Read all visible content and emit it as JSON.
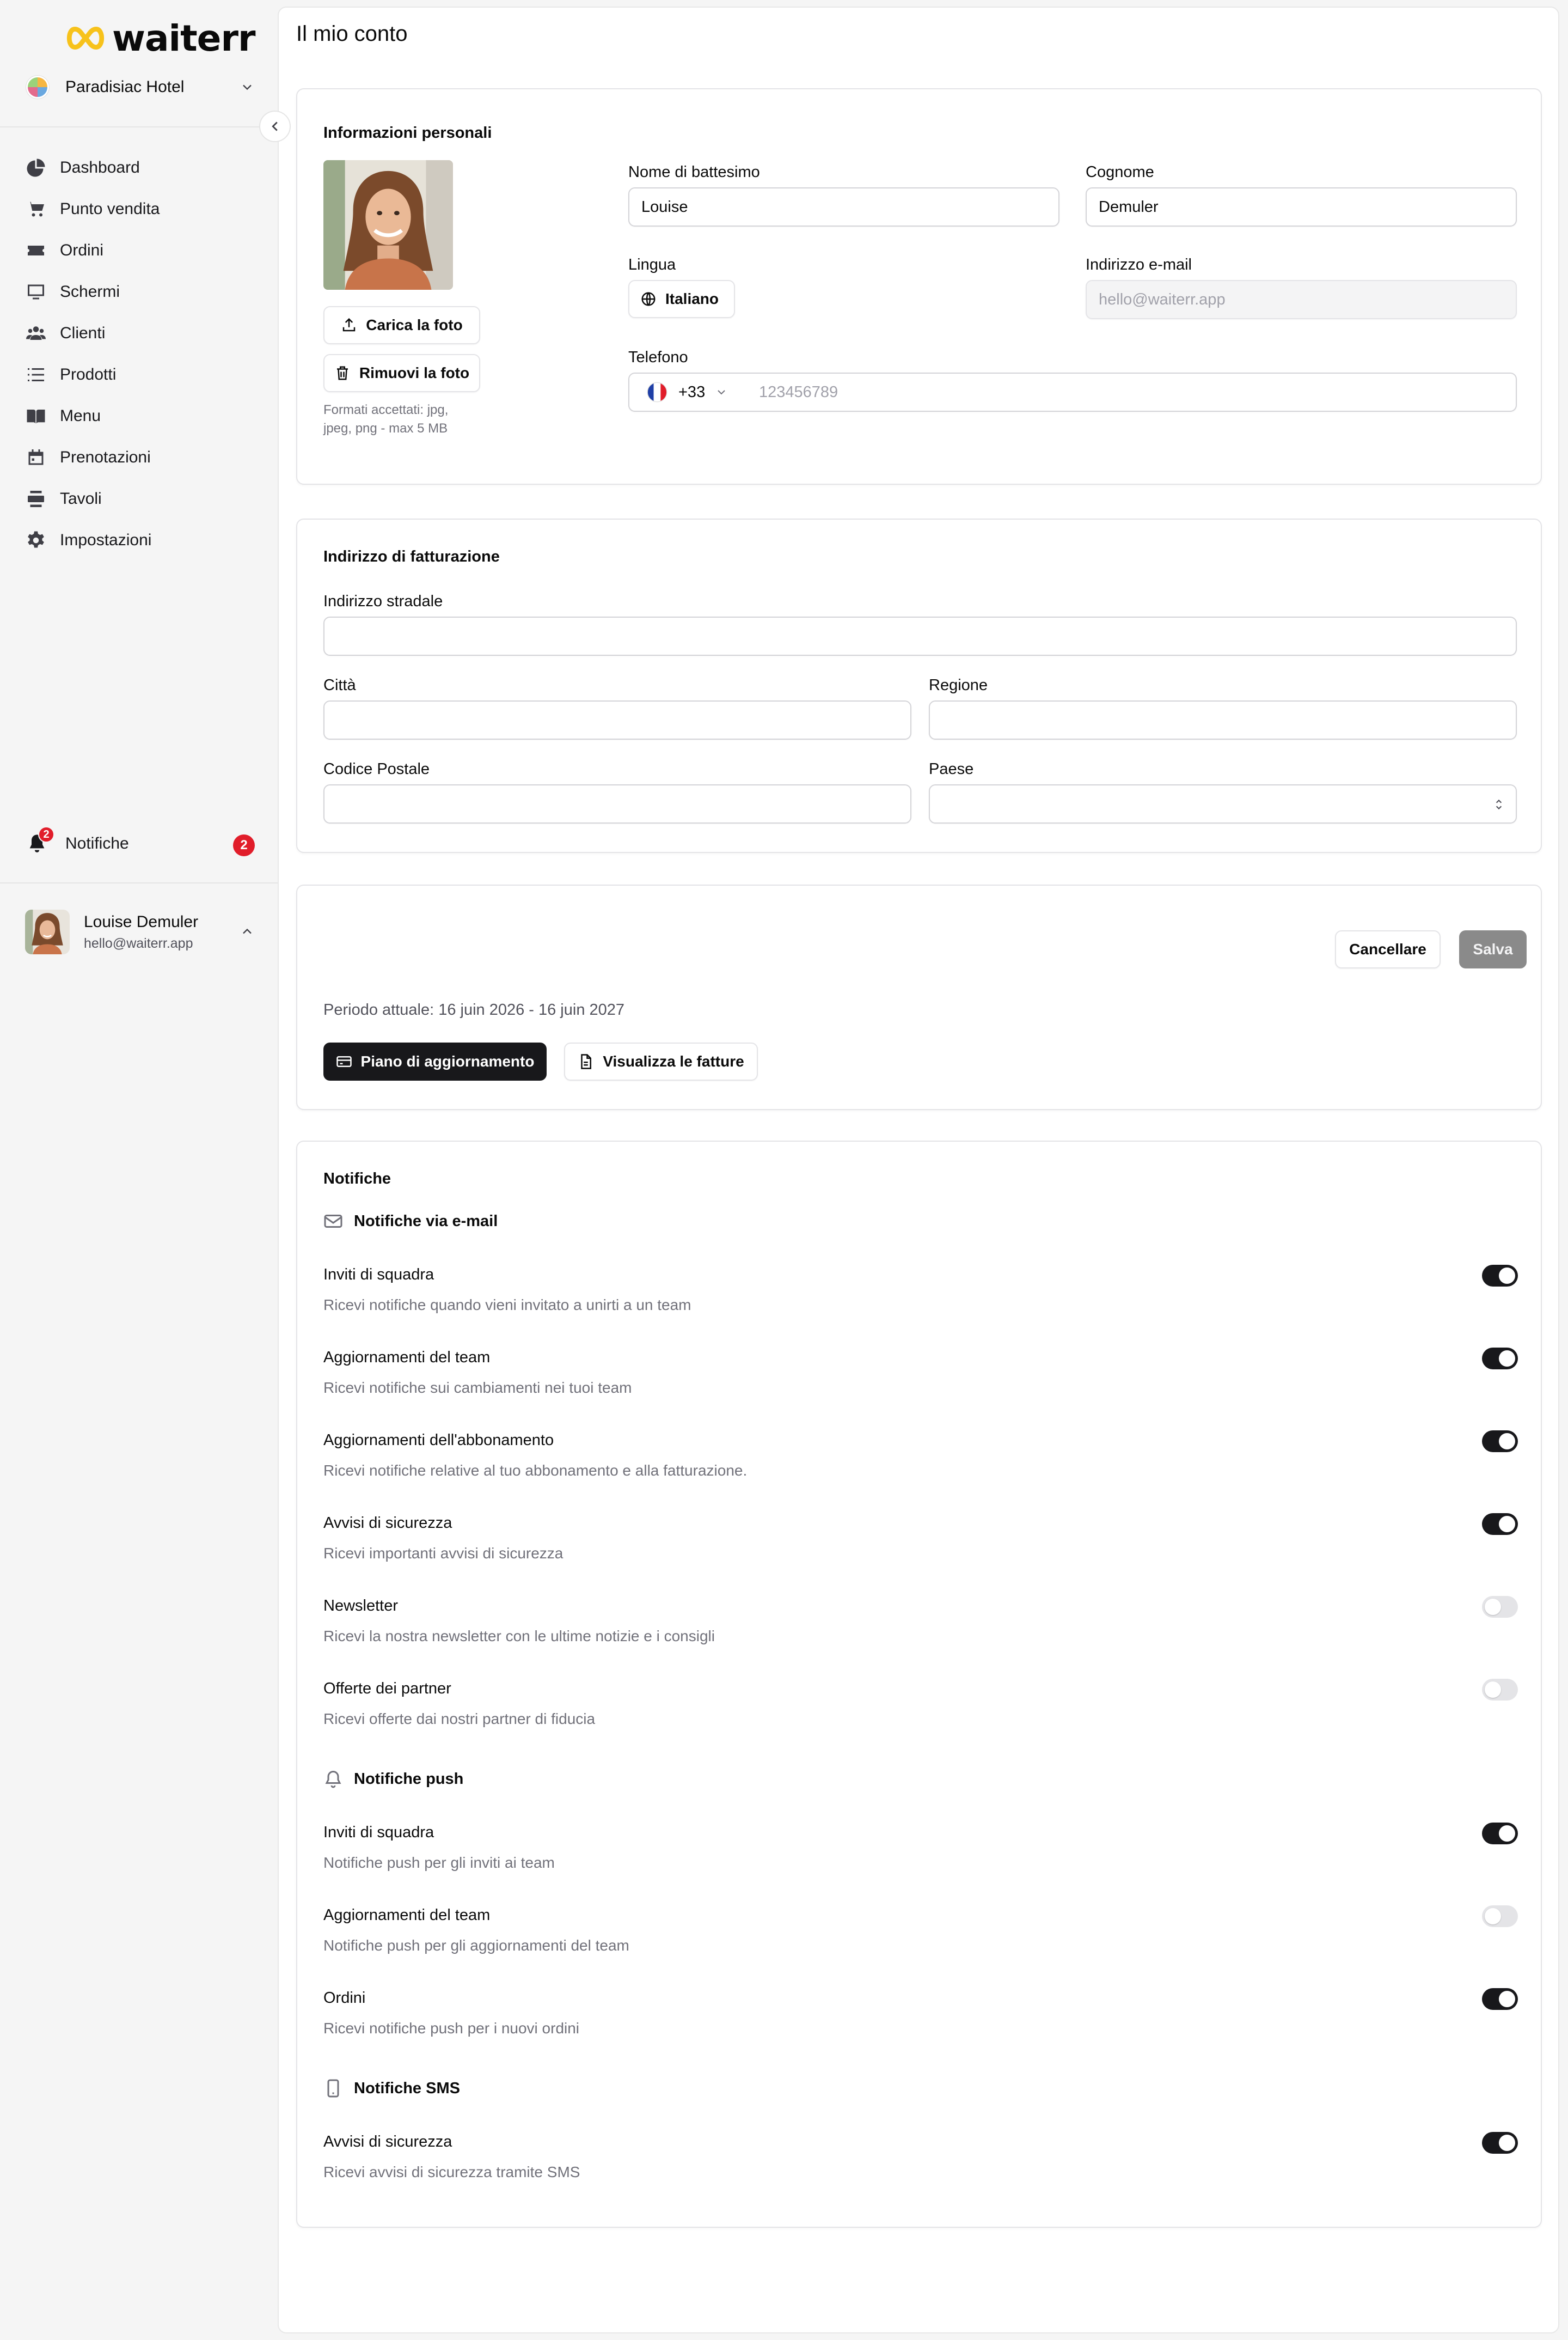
{
  "brand": {
    "name": "waiterr"
  },
  "workspace": {
    "name": "Paradisiac Hotel"
  },
  "nav": {
    "items": [
      {
        "label": "Dashboard",
        "icon": "pie-chart-icon"
      },
      {
        "label": "Punto vendita",
        "icon": "cart-icon"
      },
      {
        "label": "Ordini",
        "icon": "ticket-icon"
      },
      {
        "label": "Schermi",
        "icon": "monitor-icon"
      },
      {
        "label": "Clienti",
        "icon": "users-icon"
      },
      {
        "label": "Prodotti",
        "icon": "list-icon"
      },
      {
        "label": "Menu",
        "icon": "book-icon"
      },
      {
        "label": "Prenotazioni",
        "icon": "calendar-icon"
      },
      {
        "label": "Tavoli",
        "icon": "table-icon"
      },
      {
        "label": "Impostazioni",
        "icon": "gear-icon"
      }
    ],
    "notifications": {
      "label": "Notifiche",
      "badge": "2",
      "count": "2"
    }
  },
  "user": {
    "name": "Louise Demuler",
    "email": "hello@waiterr.app"
  },
  "page": {
    "title": "Il mio conto"
  },
  "personal": {
    "title": "Informazioni personali",
    "upload_label": "Carica la foto",
    "remove_label": "Rimuovi la foto",
    "formats_hint": "Formati accettati: jpg, jpeg, png - max 5 MB",
    "first_name_label": "Nome di battesimo",
    "first_name_value": "Louise",
    "last_name_label": "Cognome",
    "last_name_value": "Demuler",
    "language_label": "Lingua",
    "language_value": "Italiano",
    "email_label": "Indirizzo e-mail",
    "email_placeholder": "hello@waiterr.app",
    "phone_label": "Telefono",
    "phone_code": "+33",
    "phone_placeholder": "123456789"
  },
  "billing": {
    "title": "Indirizzo di fatturazione",
    "street_label": "Indirizzo stradale",
    "city_label": "Città",
    "region_label": "Regione",
    "postal_label": "Codice Postale",
    "country_label": "Paese"
  },
  "subscription": {
    "cancel_label": "Cancellare",
    "save_label": "Salva",
    "period": "Periodo attuale: 16 juin 2026 - 16 juin 2027",
    "upgrade_label": "Piano di aggiornamento",
    "invoices_label": "Visualizza le fatture"
  },
  "notifications": {
    "title": "Notifiche",
    "email_section": "Notifiche via e-mail",
    "push_section": "Notifiche push",
    "sms_section": "Notifiche SMS",
    "email_items": [
      {
        "title": "Inviti di squadra",
        "desc": "Ricevi notifiche quando vieni invitato a unirti a un team",
        "enabled": true
      },
      {
        "title": "Aggiornamenti del team",
        "desc": "Ricevi notifiche sui cambiamenti nei tuoi team",
        "enabled": true
      },
      {
        "title": "Aggiornamenti dell'abbonamento",
        "desc": "Ricevi notifiche relative al tuo abbonamento e alla fatturazione.",
        "enabled": true
      },
      {
        "title": "Avvisi di sicurezza",
        "desc": "Ricevi importanti avvisi di sicurezza",
        "enabled": true
      },
      {
        "title": "Newsletter",
        "desc": "Ricevi la nostra newsletter con le ultime notizie e i consigli",
        "enabled": false
      },
      {
        "title": "Offerte dei partner",
        "desc": "Ricevi offerte dai nostri partner di fiducia",
        "enabled": false
      }
    ],
    "push_items": [
      {
        "title": "Inviti di squadra",
        "desc": "Notifiche push per gli inviti ai team",
        "enabled": true
      },
      {
        "title": "Aggiornamenti del team",
        "desc": "Notifiche push per gli aggiornamenti del team",
        "enabled": false
      },
      {
        "title": "Ordini",
        "desc": "Ricevi notifiche push per i nuovi ordini",
        "enabled": true
      }
    ],
    "sms_items": [
      {
        "title": "Avvisi di sicurezza",
        "desc": "Ricevi avvisi di sicurezza tramite SMS",
        "enabled": true
      }
    ]
  }
}
